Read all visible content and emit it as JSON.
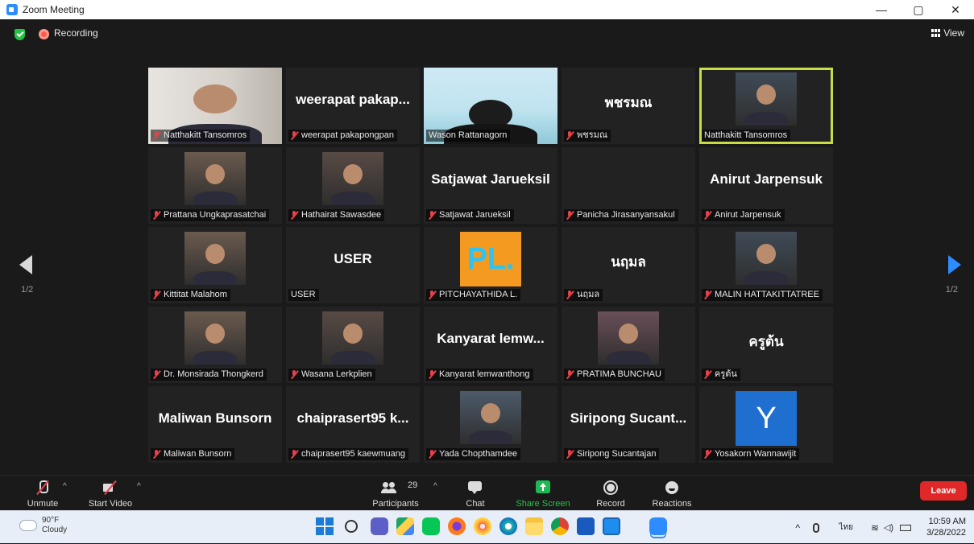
{
  "window": {
    "title": "Zoom Meeting",
    "minimize": "—",
    "restore": "▢",
    "close": "✕"
  },
  "topbar": {
    "recording_label": "Recording",
    "view_label": "View"
  },
  "pagination": {
    "left": "1/2",
    "right": "1/2"
  },
  "tiles": [
    {
      "display": "photo",
      "label": "Natthakitt Tansomros",
      "muted": true
    },
    {
      "display": "name",
      "bigname": "weerapat  pakap...",
      "label": "weerapat pakapongpan",
      "muted": true
    },
    {
      "display": "photo",
      "label": "Wason Rattanagorn",
      "muted": false
    },
    {
      "display": "name",
      "bigname": "พชรมณ",
      "label": "พชรมณ",
      "muted": true
    },
    {
      "display": "photo",
      "label": "Natthakitt Tansomros",
      "muted": false,
      "active": true
    },
    {
      "display": "photo",
      "label": "Prattana  Ungkaprasatchai",
      "muted": true
    },
    {
      "display": "photo",
      "label": "Hathairat Sawasdee",
      "muted": true
    },
    {
      "display": "name",
      "bigname": "Satjawat Jarueksil",
      "label": "Satjawat Jarueksil",
      "muted": true
    },
    {
      "display": "name",
      "bigname": "",
      "label": "Panicha Jirasanyansakul",
      "muted": true
    },
    {
      "display": "name",
      "bigname": "Anirut Jarpensuk",
      "label": "Anirut Jarpensuk",
      "muted": true
    },
    {
      "display": "photo",
      "label": "Kittitat Malahom",
      "muted": true
    },
    {
      "display": "name",
      "bigname": "USER",
      "label": "USER",
      "muted": false
    },
    {
      "display": "logo",
      "logo_text": "PL.",
      "label": "PITCHAYATHIDA L.",
      "muted": true
    },
    {
      "display": "name",
      "bigname": "นฤมล",
      "label": "นฤมล",
      "muted": true
    },
    {
      "display": "photo",
      "label": "MALIN HATTAKITTATREE",
      "muted": true
    },
    {
      "display": "photo",
      "label": "Dr. Monsirada Thongkerd",
      "muted": true
    },
    {
      "display": "photo",
      "label": "Wasana  Lerkplien",
      "muted": true
    },
    {
      "display": "name",
      "bigname": "Kanyarat  lemw...",
      "label": "Kanyarat lemwanthong",
      "muted": true
    },
    {
      "display": "photo",
      "label": "PRATIMA BUNCHAU",
      "muted": true
    },
    {
      "display": "name",
      "bigname": "ครูต้น",
      "label": "ครูต้น",
      "muted": true
    },
    {
      "display": "name",
      "bigname": "Maliwan Bunsorn",
      "label": "Maliwan Bunsorn",
      "muted": true
    },
    {
      "display": "name",
      "bigname": "chaiprasert95  k...",
      "label": "chaiprasert95 kaewmuang",
      "muted": true
    },
    {
      "display": "photo",
      "label": "Yada Chopthamdee",
      "muted": true
    },
    {
      "display": "name",
      "bigname": "Siripong  Sucant...",
      "label": "Siripong Sucantajan",
      "muted": true
    },
    {
      "display": "avatar",
      "avatar_letter": "Y",
      "label": "Yosakorn Wannawijit",
      "muted": true
    }
  ],
  "controls": {
    "unmute": "Unmute",
    "start_video": "Start Video",
    "participants": "Participants",
    "participants_count": "29",
    "chat": "Chat",
    "share_screen": "Share Screen",
    "record": "Record",
    "reactions": "Reactions",
    "leave": "Leave"
  },
  "taskbar": {
    "weather_temp": "90°F",
    "weather_desc": "Cloudy",
    "language": "ไทย",
    "time": "10:59 AM",
    "date": "3/28/2022"
  },
  "colors": {
    "accent": "#2d8cff",
    "active_speaker": "#c8dd44",
    "leave": "#e02828",
    "share": "#1db954",
    "muted": "#e5414a"
  }
}
